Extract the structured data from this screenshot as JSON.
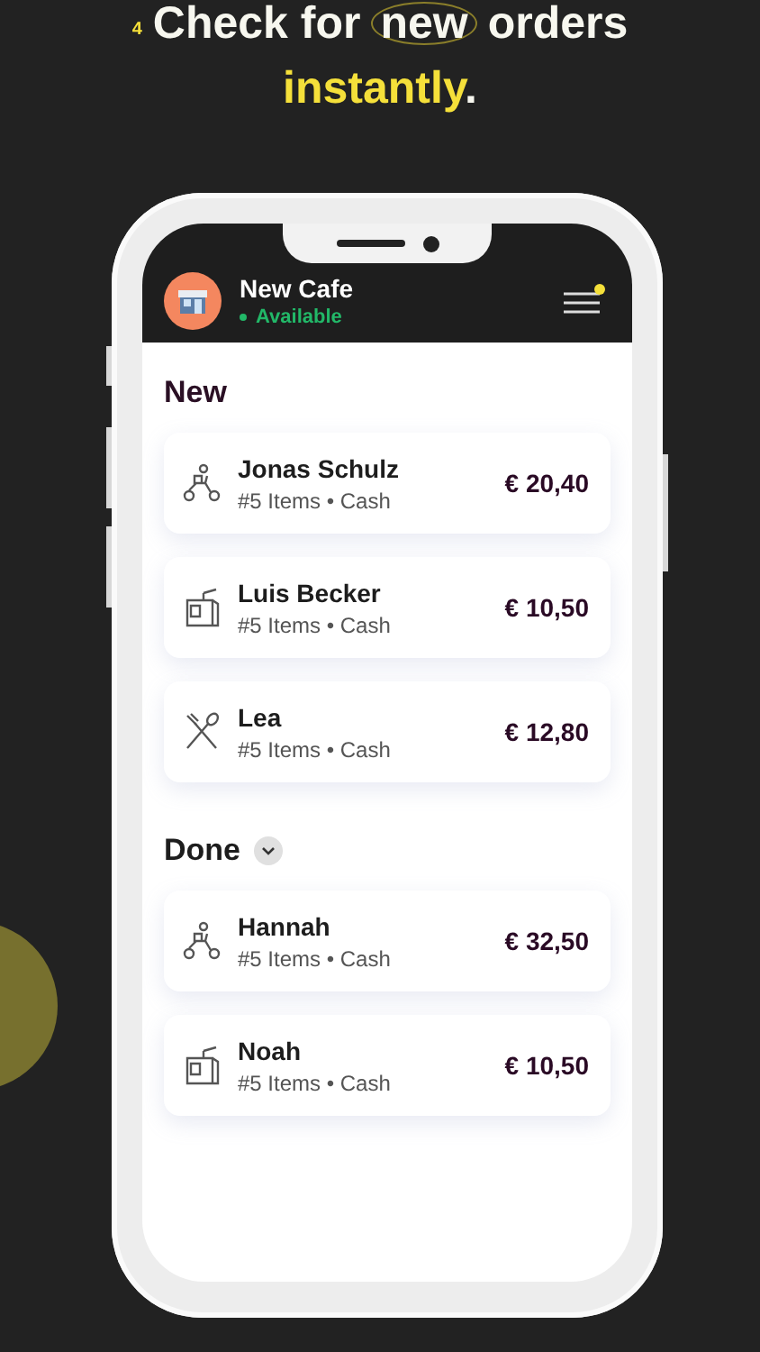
{
  "headline": {
    "step": "4",
    "before": "Check for",
    "circled": "new",
    "after": "orders",
    "highlight": "instantly",
    "end": "."
  },
  "header": {
    "title": "New Cafe",
    "status": "Available",
    "menu_badge": true
  },
  "sections": [
    {
      "title": "New",
      "toggle": false,
      "orders": [
        {
          "kind": "scooter",
          "name": "Jonas Schulz",
          "details": "#5 Items • Cash",
          "price": "€ 20,40"
        },
        {
          "kind": "bag",
          "name": "Luis Becker",
          "details": "#5 Items • Cash",
          "price": "€ 10,50"
        },
        {
          "kind": "cutlery",
          "name": "Lea",
          "details": "#5 Items • Cash",
          "price": "€ 12,80"
        }
      ]
    },
    {
      "title": "Done",
      "toggle": true,
      "orders": [
        {
          "kind": "scooter",
          "name": "Hannah",
          "details": "#5 Items • Cash",
          "price": "€ 32,50"
        },
        {
          "kind": "bag",
          "name": "Noah",
          "details": "#5 Items • Cash",
          "price": "€ 10,50"
        }
      ]
    }
  ]
}
